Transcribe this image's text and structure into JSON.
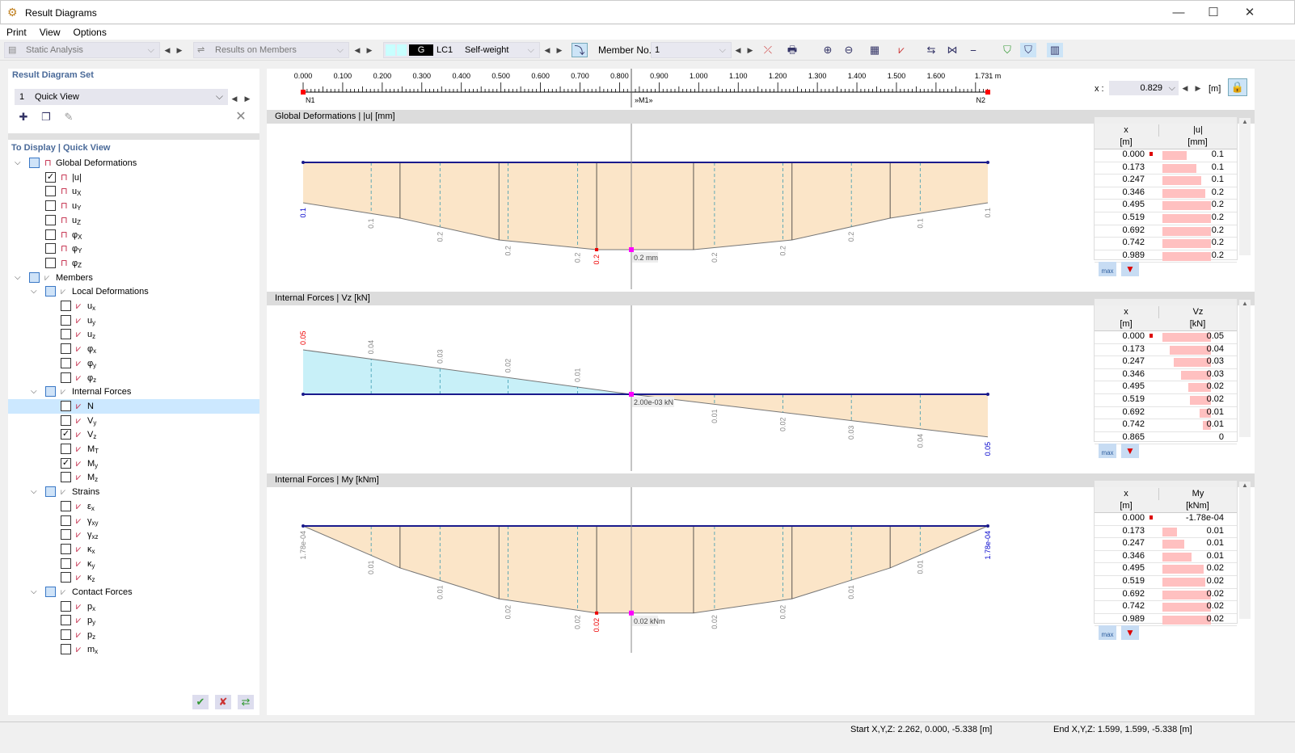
{
  "window": {
    "title": "Result Diagrams",
    "minimize": "—",
    "maximize": "☐",
    "close": "✕"
  },
  "menu": [
    "Print",
    "View",
    "Options"
  ],
  "toolbar": {
    "analysis": "Static Analysis",
    "results": "Results on Members",
    "lc_badge": "G",
    "lc": "LC1",
    "lc_name": "Self-weight",
    "member_label": "Member No.",
    "member_no": "1"
  },
  "left": {
    "set_title": "Result Diagram Set",
    "set_no": "1",
    "set_name": "Quick View",
    "display_title": "To Display | Quick View",
    "tree": [
      {
        "lv": 0,
        "exp": true,
        "cb": "part",
        "label": "Global Deformations",
        "icon": "frame"
      },
      {
        "lv": 1,
        "cb": "on",
        "label": "|u|",
        "icon": "frame"
      },
      {
        "lv": 1,
        "cb": "off",
        "label": "u",
        "sub": "X",
        "icon": "frame"
      },
      {
        "lv": 1,
        "cb": "off",
        "label": "u",
        "sub": "Y",
        "icon": "frame"
      },
      {
        "lv": 1,
        "cb": "off",
        "label": "u",
        "sub": "Z",
        "icon": "frame"
      },
      {
        "lv": 1,
        "cb": "off",
        "label": "φ",
        "sub": "X",
        "icon": "frame"
      },
      {
        "lv": 1,
        "cb": "off",
        "label": "φ",
        "sub": "Y",
        "icon": "frame"
      },
      {
        "lv": 1,
        "cb": "off",
        "label": "φ",
        "sub": "Z",
        "icon": "frame"
      },
      {
        "lv": 0,
        "exp": true,
        "cb": "part",
        "label": "Members",
        "icon": "member"
      },
      {
        "lv": 1,
        "exp": true,
        "cb": "part",
        "label": "Local Deformations",
        "icon": "member"
      },
      {
        "lv": 2,
        "cb": "off",
        "label": "u",
        "sub": "x"
      },
      {
        "lv": 2,
        "cb": "off",
        "label": "u",
        "sub": "y"
      },
      {
        "lv": 2,
        "cb": "off",
        "label": "u",
        "sub": "z"
      },
      {
        "lv": 2,
        "cb": "off",
        "label": "φ",
        "sub": "x"
      },
      {
        "lv": 2,
        "cb": "off",
        "label": "φ",
        "sub": "y"
      },
      {
        "lv": 2,
        "cb": "off",
        "label": "φ",
        "sub": "z"
      },
      {
        "lv": 1,
        "exp": true,
        "cb": "part",
        "label": "Internal Forces",
        "icon": "member"
      },
      {
        "lv": 2,
        "cb": "off",
        "label": "N",
        "sel": true
      },
      {
        "lv": 2,
        "cb": "off",
        "label": "V",
        "sub": "y"
      },
      {
        "lv": 2,
        "cb": "on",
        "label": "V",
        "sub": "z"
      },
      {
        "lv": 2,
        "cb": "off",
        "label": "M",
        "sub": "T"
      },
      {
        "lv": 2,
        "cb": "on",
        "label": "M",
        "sub": "y"
      },
      {
        "lv": 2,
        "cb": "off",
        "label": "M",
        "sub": "z"
      },
      {
        "lv": 1,
        "exp": true,
        "cb": "part",
        "label": "Strains",
        "icon": "member"
      },
      {
        "lv": 2,
        "cb": "off",
        "label": "ε",
        "sub": "x"
      },
      {
        "lv": 2,
        "cb": "off",
        "label": "γ",
        "sub": "xy"
      },
      {
        "lv": 2,
        "cb": "off",
        "label": "γ",
        "sub": "xz"
      },
      {
        "lv": 2,
        "cb": "off",
        "label": "κ",
        "sub": "x"
      },
      {
        "lv": 2,
        "cb": "off",
        "label": "κ",
        "sub": "y"
      },
      {
        "lv": 2,
        "cb": "off",
        "label": "κ",
        "sub": "z"
      },
      {
        "lv": 1,
        "exp": true,
        "cb": "part",
        "label": "Contact Forces",
        "icon": "member"
      },
      {
        "lv": 2,
        "cb": "off",
        "label": "p",
        "sub": "x"
      },
      {
        "lv": 2,
        "cb": "off",
        "label": "p",
        "sub": "y"
      },
      {
        "lv": 2,
        "cb": "off",
        "label": "p",
        "sub": "z"
      },
      {
        "lv": 2,
        "cb": "off",
        "label": "m",
        "sub": "x"
      }
    ]
  },
  "ruler": {
    "ticks": [
      "0.000",
      "0.100",
      "0.200",
      "0.300",
      "0.400",
      "0.500",
      "0.600",
      "0.700",
      "0.800",
      "0.900",
      "1.000",
      "1.100",
      "1.200",
      "1.300",
      "1.400",
      "1.500",
      "1.600"
    ],
    "end_label": "1.731 m",
    "length": 1.731,
    "node_start": "N1",
    "node_end": "N2",
    "member": "»M1»",
    "x_label": "x :",
    "x_value": "0.829",
    "x_unit": "[m]"
  },
  "colors": {
    "negative_fill": "#fbe5c8",
    "positive_fill": "#c8f0f8",
    "beam": "#1a1a8c",
    "extreme": "#ff0000",
    "table_bar": "#ffc0c0"
  },
  "diagrams": [
    {
      "title": "Global Deformations | |u| [mm]",
      "scale": 500,
      "points": [
        [
          0,
          0.1
        ],
        [
          0.245,
          0.138
        ],
        [
          0.495,
          0.192
        ],
        [
          0.742,
          0.216
        ],
        [
          0.987,
          0.216
        ],
        [
          1.236,
          0.192
        ],
        [
          1.484,
          0.138
        ],
        [
          1.731,
          0.1
        ]
      ],
      "labels": [
        [
          0,
          "0.1",
          "b"
        ],
        [
          0.172,
          "0.1"
        ],
        [
          0.346,
          "0.2"
        ],
        [
          0.518,
          "0.2"
        ],
        [
          0.694,
          "0.2"
        ],
        [
          0.742,
          "0.2",
          "r"
        ],
        [
          1.04,
          "0.2"
        ],
        [
          1.213,
          "0.2"
        ],
        [
          1.386,
          "0.2"
        ],
        [
          1.56,
          "0.1"
        ],
        [
          1.731,
          "0.1"
        ]
      ],
      "cursor_label": "0.2 mm",
      "table": {
        "h1": "x",
        "h1u": "[m]",
        "h2": "|u|",
        "h2u": "[mm]",
        "rows": [
          [
            "0.000",
            "0.1",
            0.5
          ],
          [
            "0.173",
            "0.1",
            0.7
          ],
          [
            "0.247",
            "0.1",
            0.8
          ],
          [
            "0.346",
            "0.2",
            0.88
          ],
          [
            "0.495",
            "0.2",
            1
          ],
          [
            "0.519",
            "0.2",
            1
          ],
          [
            "0.692",
            "0.2",
            1
          ],
          [
            "0.742",
            "0.2",
            1
          ],
          [
            "0.989",
            "0.2",
            1
          ]
        ]
      }
    },
    {
      "title": "Internal Forces | Vz [kN]",
      "scale": 1100,
      "points": [
        [
          0,
          -0.05
        ],
        [
          0.829,
          0
        ],
        [
          1.731,
          0.048
        ]
      ],
      "labels": [
        [
          0,
          "0.05",
          "r"
        ],
        [
          0.172,
          "0.04"
        ],
        [
          0.346,
          "0.03"
        ],
        [
          0.518,
          "0.02"
        ],
        [
          0.694,
          "0.01"
        ],
        [
          1.04,
          "0.01"
        ],
        [
          1.213,
          "0.02"
        ],
        [
          1.386,
          "0.03"
        ],
        [
          1.56,
          "0.04"
        ],
        [
          1.731,
          "0.05",
          "b"
        ]
      ],
      "cursor_label": "2.00e-03 kN",
      "table": {
        "h1": "x",
        "h1u": "[m]",
        "h2": "Vz",
        "h2u": "[kN]",
        "rows": [
          [
            "0.000",
            "0.05",
            1
          ],
          [
            "0.173",
            "0.04",
            0.85
          ],
          [
            "0.247",
            "0.03",
            0.77
          ],
          [
            "0.346",
            "0.03",
            0.62
          ],
          [
            "0.495",
            "0.02",
            0.47
          ],
          [
            "0.519",
            "0.02",
            0.44
          ],
          [
            "0.692",
            "0.01",
            0.24
          ],
          [
            "0.742",
            "0.01",
            0.16
          ],
          [
            "0.865",
            "0",
            0
          ]
        ]
      }
    },
    {
      "title": "Internal Forces | My [kNm]",
      "scale": 4900,
      "points": [
        [
          0,
          0
        ],
        [
          0.245,
          0.0106
        ],
        [
          0.495,
          0.0184
        ],
        [
          0.742,
          0.022
        ],
        [
          0.987,
          0.022
        ],
        [
          1.236,
          0.0184
        ],
        [
          1.484,
          0.0106
        ],
        [
          1.731,
          0
        ]
      ],
      "labels": [
        [
          0,
          "1.78e-04",
          "g"
        ],
        [
          0.172,
          "0.01"
        ],
        [
          0.346,
          "0.01"
        ],
        [
          0.518,
          "0.02"
        ],
        [
          0.694,
          "0.02"
        ],
        [
          0.742,
          "0.02",
          "r"
        ],
        [
          1.04,
          "0.02"
        ],
        [
          1.213,
          "0.02"
        ],
        [
          1.386,
          "0.01"
        ],
        [
          1.56,
          "0.01"
        ],
        [
          1.731,
          "1.78e-04",
          "b"
        ]
      ],
      "cursor_label": "0.02 kNm",
      "table": {
        "h1": "x",
        "h1u": "[m]",
        "h2": "My",
        "h2u": "[kNm]",
        "rows": [
          [
            "0.000",
            "-1.78e-04",
            0
          ],
          [
            "0.173",
            "0.01",
            0.3
          ],
          [
            "0.247",
            "0.01",
            0.45
          ],
          [
            "0.346",
            "0.01",
            0.6
          ],
          [
            "0.495",
            "0.02",
            0.85
          ],
          [
            "0.519",
            "0.02",
            0.88
          ],
          [
            "0.692",
            "0.02",
            1
          ],
          [
            "0.742",
            "0.02",
            1
          ],
          [
            "0.989",
            "0.02",
            1
          ]
        ]
      }
    }
  ],
  "filter": {
    "max": "max"
  },
  "status": {
    "start": "Start X,Y,Z: 2.262, 0.000, -5.338 [m]",
    "end": "End X,Y,Z: 1.599, 1.599, -5.338 [m]"
  }
}
